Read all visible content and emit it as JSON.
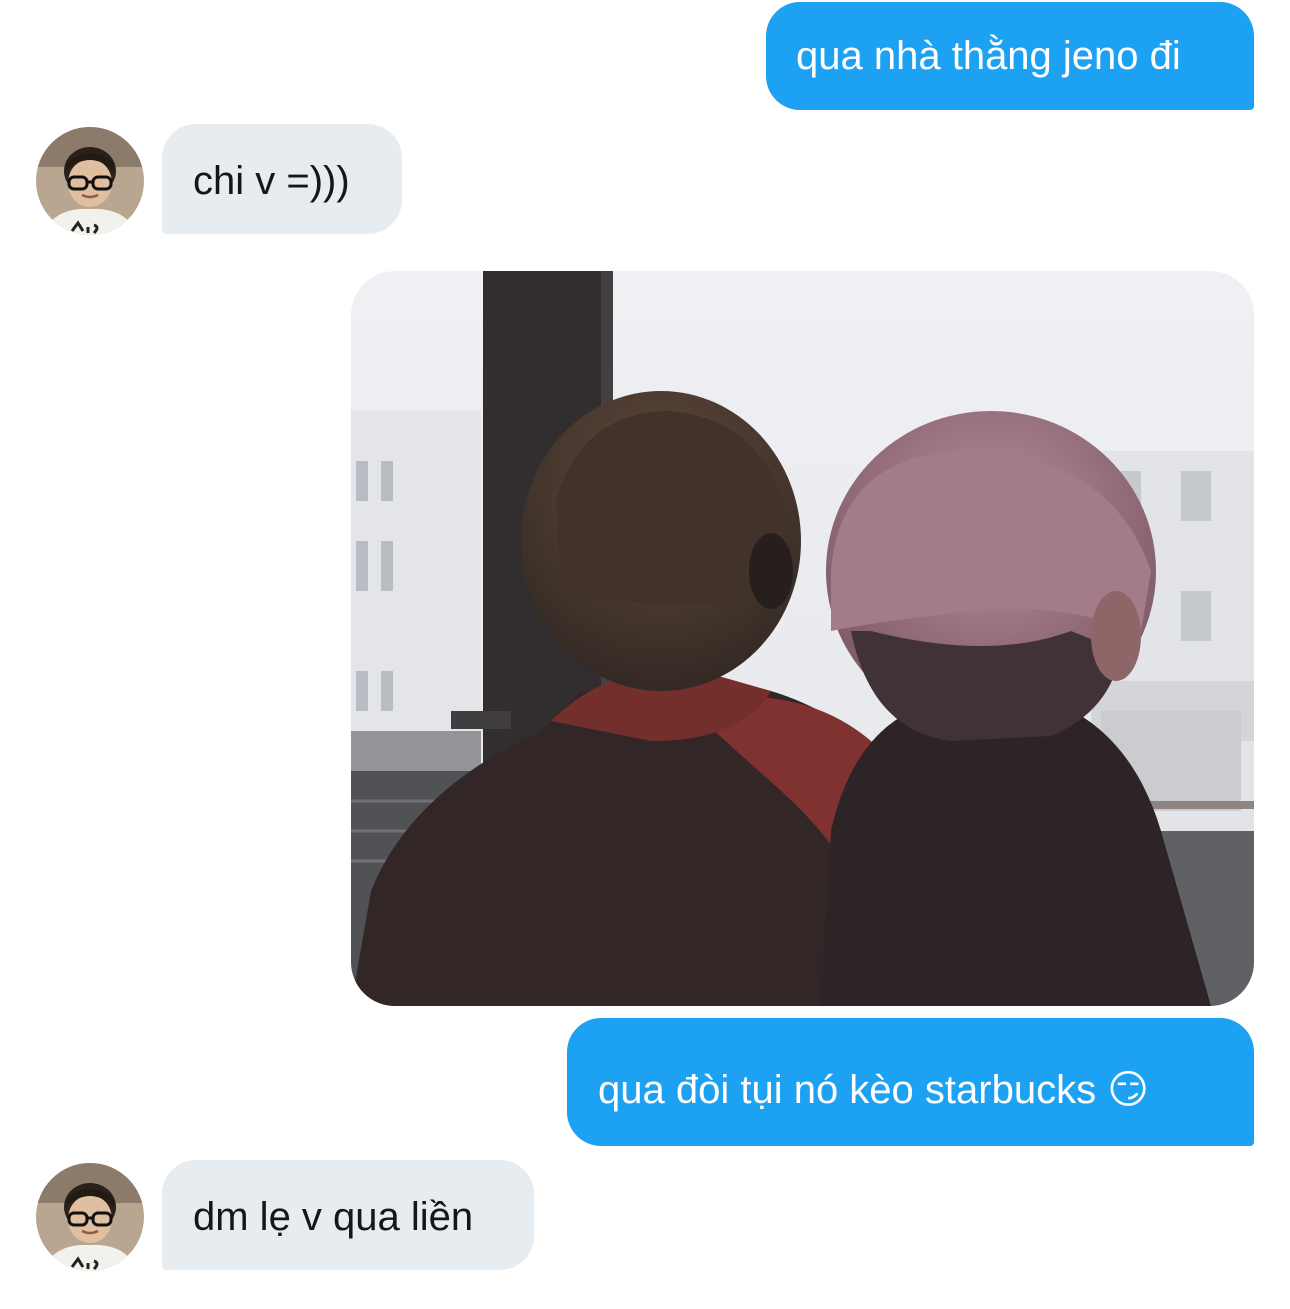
{
  "conversation": {
    "messages": [
      {
        "sender": "self",
        "type": "text",
        "text": "qua nhà thằng jeno đi"
      },
      {
        "sender": "other",
        "type": "text",
        "text": "chi v =)))"
      },
      {
        "sender": "self",
        "type": "image"
      },
      {
        "sender": "self",
        "type": "text",
        "text": "qua đòi tụi nó kèo starbucks 😏"
      },
      {
        "sender": "other",
        "type": "text",
        "text": "dm lẹ v qua liền"
      }
    ]
  },
  "colors": {
    "sent_bubble": "#1da1f2",
    "received_bubble": "#e6ecf0",
    "received_text": "#14171a",
    "background": "#ffffff"
  }
}
